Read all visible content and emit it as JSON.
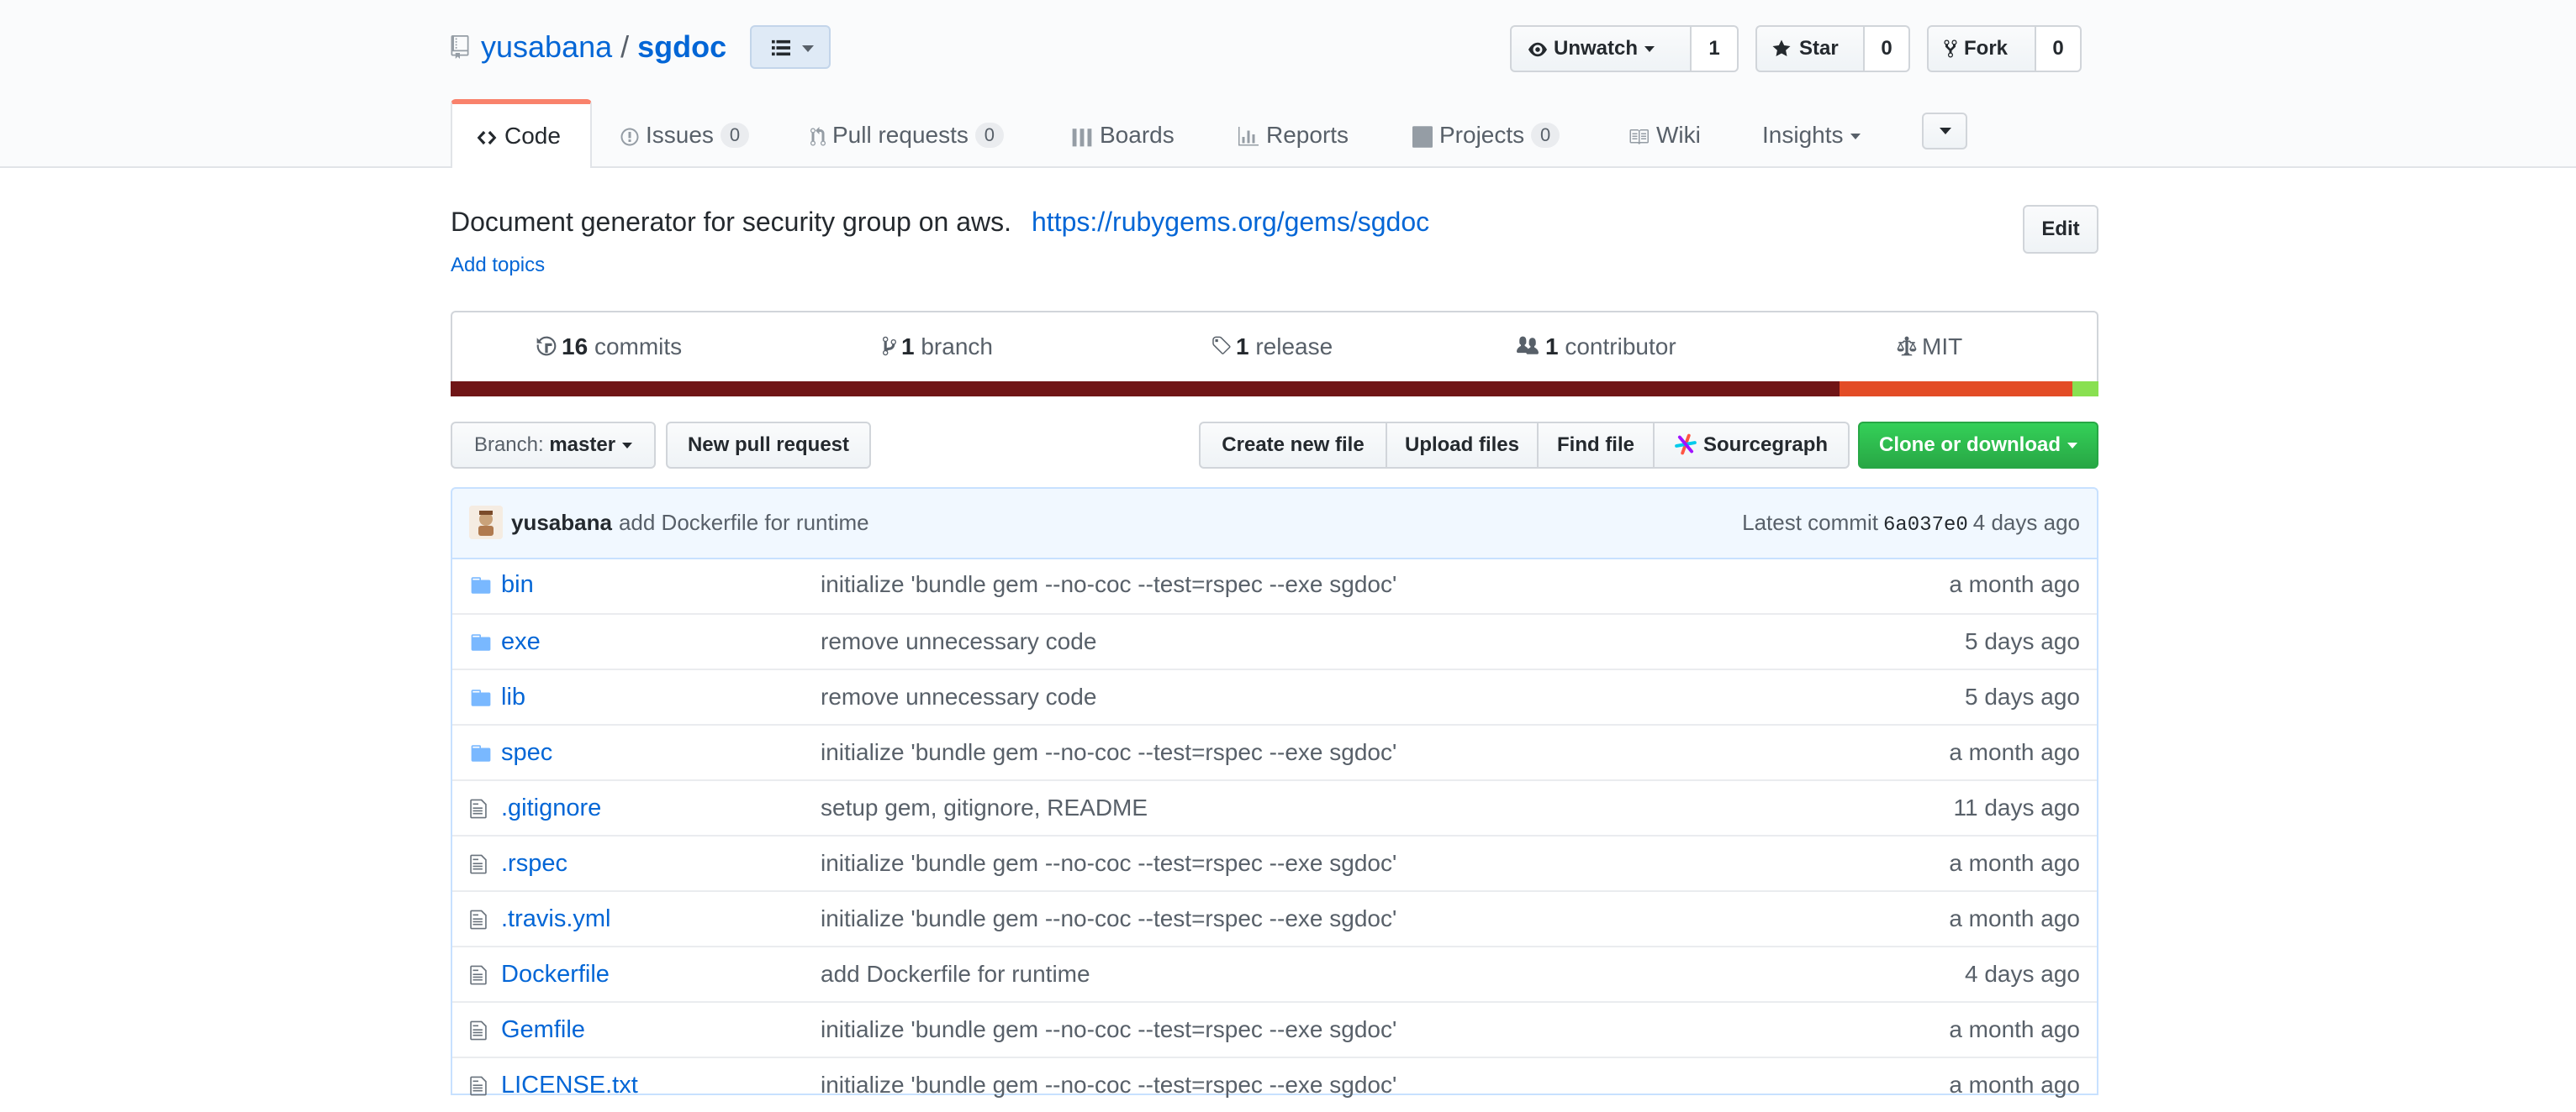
{
  "repo": {
    "owner": "yusabana",
    "separator": "/",
    "name": "sgdoc"
  },
  "actions": {
    "watch_label": "Unwatch",
    "watch_count": "1",
    "star_label": "Star",
    "star_count": "0",
    "fork_label": "Fork",
    "fork_count": "0"
  },
  "tabs": [
    {
      "label": "Code",
      "icon": "code-icon"
    },
    {
      "label": "Issues",
      "icon": "issue-icon",
      "count": "0"
    },
    {
      "label": "Pull requests",
      "icon": "pull-request-icon",
      "count": "0"
    },
    {
      "label": "Boards",
      "icon": "boards-icon"
    },
    {
      "label": "Reports",
      "icon": "graph-icon"
    },
    {
      "label": "Projects",
      "icon": "project-icon",
      "count": "0"
    },
    {
      "label": "Wiki",
      "icon": "book-icon"
    },
    {
      "label": "Insights",
      "icon": "chevron-down-icon"
    }
  ],
  "description": {
    "text": "Document generator for security group on aws.",
    "url": "https://rubygems.org/gems/sgdoc",
    "add_topics": "Add topics",
    "edit_label": "Edit"
  },
  "summary": {
    "commits_count": "16",
    "commits_label": "commits",
    "branch_count": "1",
    "branch_label": "branch",
    "release_count": "1",
    "release_label": "release",
    "contributor_count": "1",
    "contributor_label": "contributor",
    "license": "MIT"
  },
  "languages": [
    {
      "color": "#701516",
      "share": 0.843
    },
    {
      "color": "#e34c26",
      "share": 0.141
    },
    {
      "color": "#89e051",
      "share": 0.016
    }
  ],
  "filenav": {
    "branch_prefix": "Branch:",
    "branch_name": "master",
    "new_pr": "New pull request",
    "create_file": "Create new file",
    "upload_files": "Upload files",
    "find_file": "Find file",
    "sourcegraph": "Sourcegraph",
    "clone": "Clone or download"
  },
  "latest_commit": {
    "author": "yusabana",
    "message": "add Dockerfile for runtime",
    "label": "Latest commit",
    "sha": "6a037e0",
    "age": "4 days ago"
  },
  "files": [
    {
      "name": "bin",
      "type": "dir",
      "message": "initialize 'bundle gem --no-coc --test=rspec --exe sgdoc'",
      "age": "a month ago"
    },
    {
      "name": "exe",
      "type": "dir",
      "message": "remove unnecessary code",
      "age": "5 days ago"
    },
    {
      "name": "lib",
      "type": "dir",
      "message": "remove unnecessary code",
      "age": "5 days ago"
    },
    {
      "name": "spec",
      "type": "dir",
      "message": "initialize 'bundle gem --no-coc --test=rspec --exe sgdoc'",
      "age": "a month ago"
    },
    {
      "name": ".gitignore",
      "type": "file",
      "message": "setup gem, gitignore, README",
      "age": "11 days ago"
    },
    {
      "name": ".rspec",
      "type": "file",
      "message": "initialize 'bundle gem --no-coc --test=rspec --exe sgdoc'",
      "age": "a month ago"
    },
    {
      "name": ".travis.yml",
      "type": "file",
      "message": "initialize 'bundle gem --no-coc --test=rspec --exe sgdoc'",
      "age": "a month ago"
    },
    {
      "name": "Dockerfile",
      "type": "file",
      "message": "add Dockerfile for runtime",
      "age": "4 days ago"
    },
    {
      "name": "Gemfile",
      "type": "file",
      "message": "initialize 'bundle gem --no-coc --test=rspec --exe sgdoc'",
      "age": "a month ago"
    },
    {
      "name": "LICENSE.txt",
      "type": "file",
      "message": "initialize 'bundle gem --no-coc --test=rspec --exe sgdoc'",
      "age": "a month ago"
    }
  ]
}
